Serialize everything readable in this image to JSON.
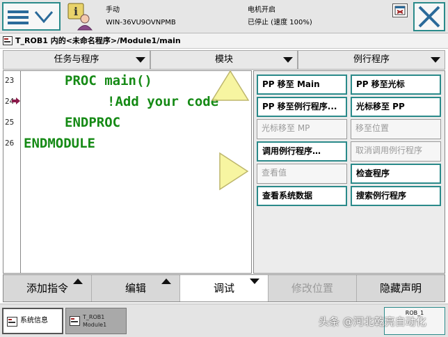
{
  "status": {
    "mode": "手动",
    "controller": "WIN-36VU9OVNPMB",
    "motor_state": "电机开启",
    "run_state": "已停止 (速度 100%)"
  },
  "path": "T_ROB1 内的<未命名程序>/Module1/main",
  "selectors": [
    "任务与程序",
    "模块",
    "例行程序"
  ],
  "editor": {
    "line_numbers": [
      "23",
      "24",
      "25",
      "26"
    ],
    "lines": [
      "PROC main()",
      "!Add your code",
      "ENDPROC",
      "ENDMODULE"
    ],
    "code_color": "#158a15"
  },
  "debug_menu": {
    "items": [
      {
        "label": "PP 移至 Main",
        "enabled": true
      },
      {
        "label": "PP 移至光标",
        "enabled": true
      },
      {
        "label": "PP 移至例行程序...",
        "enabled": true
      },
      {
        "label": "光标移至 PP",
        "enabled": true
      },
      {
        "label": "光标移至 MP",
        "enabled": false
      },
      {
        "label": "移至位置",
        "enabled": false
      },
      {
        "label": "调用例行程序…",
        "enabled": true
      },
      {
        "label": "取消调用例行程序",
        "enabled": false
      },
      {
        "label": "查看值",
        "enabled": false
      },
      {
        "label": "检查程序",
        "enabled": true
      },
      {
        "label": "查看系统数据",
        "enabled": true
      },
      {
        "label": "搜索例行程序",
        "enabled": true
      }
    ]
  },
  "commands": [
    {
      "label": "添加指令",
      "arrow": "up"
    },
    {
      "label": "编辑",
      "arrow": "up"
    },
    {
      "label": "调试",
      "arrow": "down",
      "active": true
    },
    {
      "label": "修改位置",
      "disabled": true
    },
    {
      "label": "隐藏声明"
    }
  ],
  "taskbar": {
    "task1": "系统信息",
    "task2_line1": "T_ROB1",
    "task2_line2": "Module1",
    "quickset_label": "ROB_1"
  },
  "watermark": "头条 @河北乾亮自动化",
  "colors": {
    "accent": "#2a8a8a",
    "gesture_fill": "#f7f59a"
  }
}
